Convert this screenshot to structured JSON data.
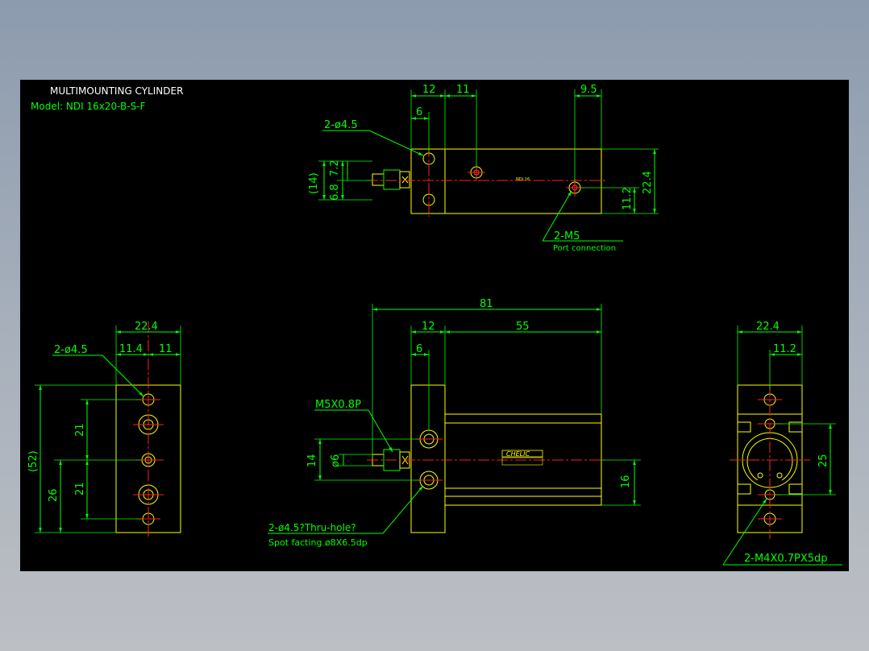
{
  "title_block": {
    "title": "MULTIMOUNTING CYLINDER",
    "model": "Model: NDI 16x20-B-S-F"
  },
  "colors": {
    "background": "#000000",
    "outline": "#ffff00",
    "dimension": "#00ff00",
    "centerline": "#ff2020",
    "text": "#ffffff"
  },
  "top_view": {
    "dims": {
      "d12": "12",
      "d11": "11",
      "d9_5": "9.5",
      "d6": "6",
      "d14": "(14)",
      "d6_8": "6.8",
      "d7_2": "7.2",
      "d22_4": "22.4",
      "d11_2": "11.2"
    },
    "callouts": {
      "holes": "2-ø4.5",
      "ports": "2-M5",
      "ports_note": "Port connection",
      "body_mark": "NDI 16"
    }
  },
  "front_view": {
    "dims": {
      "d81": "81",
      "d12": "12",
      "d55": "55",
      "d6": "6",
      "d14": "14",
      "d_phi6": "ø6",
      "d16": "16"
    },
    "callouts": {
      "thread": "M5X0.8P",
      "holes": "2-ø4.5?Thru-hole?",
      "spot": "Spot facting  ø8X6.5dp",
      "brand": "CHELIC"
    }
  },
  "left_view": {
    "dims": {
      "d22_4": "22.4",
      "d11_4": "11.4",
      "d11": "11",
      "d52": "(52)",
      "d26": "26",
      "d21a": "21",
      "d21b": "21"
    },
    "callouts": {
      "holes": "2-ø4.5"
    }
  },
  "right_view": {
    "dims": {
      "d22_4": "22.4",
      "d11_2": "11.2",
      "d25": "25"
    },
    "callouts": {
      "threads": "2-M4X0.7PX5dp"
    }
  }
}
